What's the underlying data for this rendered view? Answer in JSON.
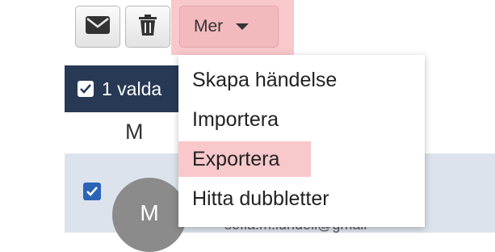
{
  "toolbar": {
    "mail_icon": "envelope-icon",
    "trash_icon": "trash-icon",
    "more_label": "Mer",
    "more_caret_icon": "caret-down-icon"
  },
  "dropdown": {
    "items": [
      {
        "label": "Skapa händelse"
      },
      {
        "label": "Importera"
      },
      {
        "label": "Exportera"
      },
      {
        "label": "Hitta dubbletter"
      }
    ],
    "highlighted_item": "Exportera",
    "highlight_color": "#f8c8cb"
  },
  "list": {
    "selection_text": "1 valda",
    "column_header": "M",
    "row": {
      "avatar_initial": "M",
      "email_fragment": "sofia.m.lundell@gmail",
      "checked": true
    }
  },
  "colors": {
    "selection_bar": "#273954",
    "row_bg": "#dde3ec",
    "checkbox": "#2b63b6",
    "avatar": "#8b8b8b"
  }
}
